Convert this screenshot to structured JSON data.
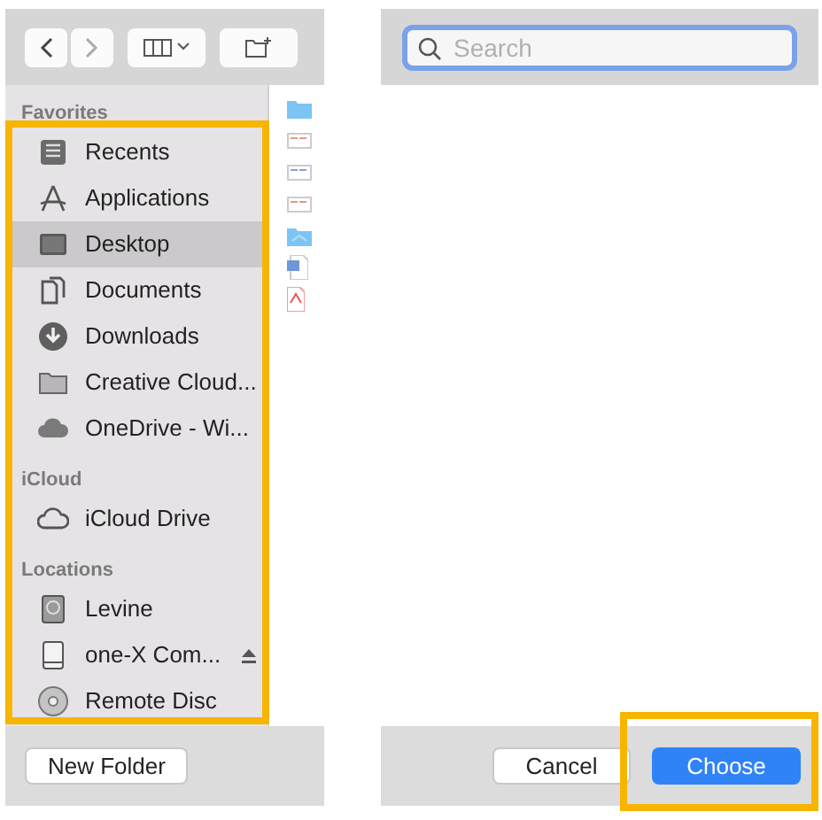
{
  "sidebar": {
    "sections": [
      {
        "title": "Favorites",
        "items": [
          {
            "label": "Recents",
            "selected": false
          },
          {
            "label": "Applications",
            "selected": false
          },
          {
            "label": "Desktop",
            "selected": true
          },
          {
            "label": "Documents",
            "selected": false
          },
          {
            "label": "Downloads",
            "selected": false
          },
          {
            "label": "Creative Cloud...",
            "selected": false
          },
          {
            "label": "OneDrive - Wi...",
            "selected": false
          }
        ]
      },
      {
        "title": "iCloud",
        "items": [
          {
            "label": "iCloud Drive",
            "selected": false
          }
        ]
      },
      {
        "title": "Locations",
        "items": [
          {
            "label": "Levine",
            "selected": false
          },
          {
            "label": "one-X Com...",
            "selected": false,
            "ejectable": true
          },
          {
            "label": "Remote Disc",
            "selected": false
          }
        ]
      }
    ]
  },
  "search": {
    "placeholder": "Search",
    "focused": true
  },
  "buttons": {
    "new_folder": "New Folder",
    "cancel": "Cancel",
    "choose": "Choose"
  }
}
